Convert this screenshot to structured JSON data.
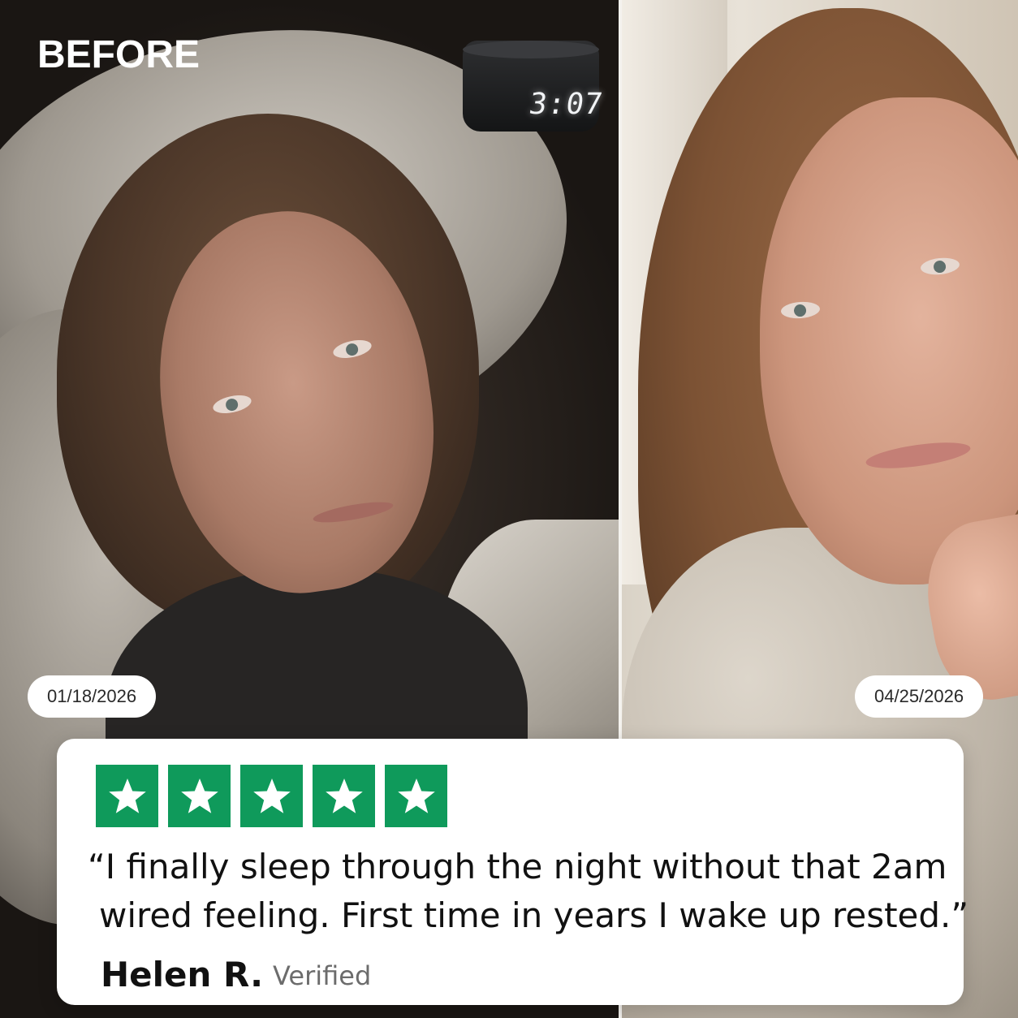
{
  "before_label": "BEFORE",
  "clock": {
    "time": "3:07"
  },
  "dates": {
    "before": "01/18/2026",
    "after": "04/25/2026"
  },
  "review": {
    "rating": 5,
    "stars": [
      "star-icon",
      "star-icon",
      "star-icon",
      "star-icon",
      "star-icon"
    ],
    "star_color": "#0f9a5b",
    "quote_line_1": "“I finally sleep through the night without that 2am",
    "quote_line_2": "wired feeling. First time in years I wake up rested.”",
    "author": "Helen R.",
    "badge": "Verified"
  }
}
